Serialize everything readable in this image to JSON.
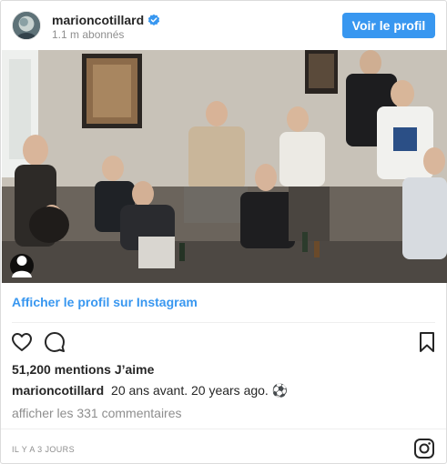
{
  "header": {
    "username": "marioncotillard",
    "followers": "1.1 m abonnés",
    "view_profile_label": "Voir le profil",
    "verified_color": "#3897f0"
  },
  "post": {
    "image_description_icon": "user-tag-icon",
    "view_on_instagram": "Afficher le profil sur Instagram",
    "likes": "51,200 mentions J’aime",
    "caption_user": "marioncotillard",
    "caption_text": "20 ans avant. 20 years ago. ⚽",
    "comments_link": "afficher les 331 commentaires",
    "timestamp": "IL Y A 3 JOURS"
  },
  "icons": {
    "like": "heart-icon",
    "comment": "comment-icon",
    "save": "bookmark-icon",
    "logo": "instagram-logo-icon"
  },
  "colors": {
    "accent": "#3897f0",
    "text": "#262626",
    "muted": "#8e8e8e"
  }
}
